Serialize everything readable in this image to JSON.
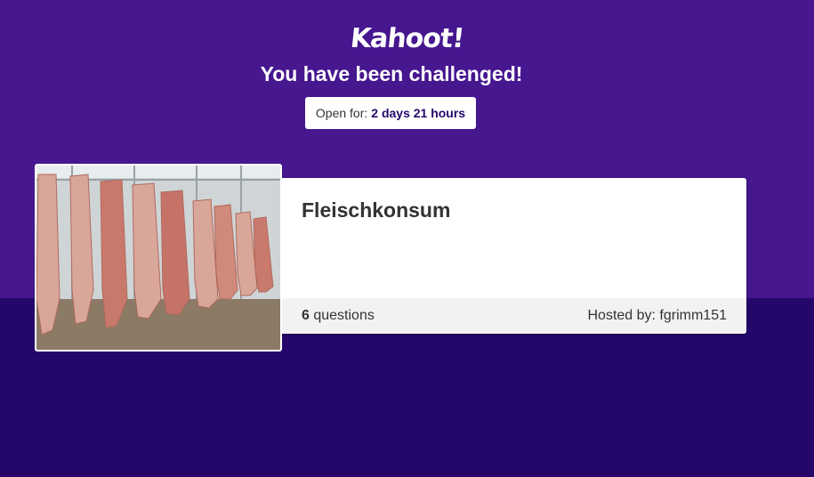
{
  "brand": {
    "logo_text": "Kahoot!"
  },
  "challenge": {
    "headline": "You have been challenged!",
    "open_for_label": "Open for:",
    "open_for_value": "2 days 21 hours"
  },
  "quiz": {
    "title": "Fleischkonsum",
    "question_count": "6",
    "questions_label": "questions",
    "host_label": "Hosted by:",
    "host_name": "fgrimm151"
  },
  "colors": {
    "top_band": "#46178f",
    "bottom_band": "#25076b",
    "card_bg": "#ffffff",
    "footer_bg": "#f2f2f2"
  }
}
